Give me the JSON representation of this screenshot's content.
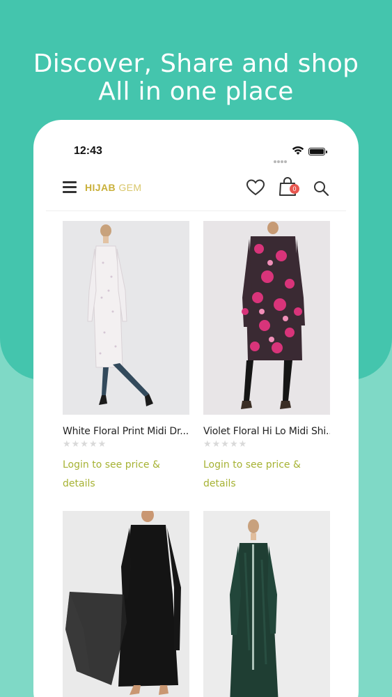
{
  "headline": {
    "line1": "Discover, Share and shop",
    "line2": "All in one place"
  },
  "status_bar": {
    "time": "12:43"
  },
  "app_bar": {
    "logo_primary": "HIJAB",
    "logo_secondary": "GEM",
    "cart_count": "0",
    "icons": [
      "menu-icon",
      "heart-icon",
      "shopping-bag-icon",
      "search-icon"
    ]
  },
  "products": [
    {
      "title": "White Floral Print Midi Dr...",
      "rating_stars": "★★★★★",
      "login_text": "Login to see price &",
      "login_text2": "details"
    },
    {
      "title": "Violet Floral Hi Lo Midi Shi...",
      "rating_stars": "★★★★★",
      "login_text": "Login to see price &",
      "login_text2": "details"
    },
    {
      "title": "",
      "rating_stars": "",
      "login_text": "",
      "login_text2": ""
    },
    {
      "title": "",
      "rating_stars": "",
      "login_text": "",
      "login_text2": ""
    }
  ],
  "colors": {
    "background_top": "#44c5ad",
    "background_bottom": "#7fd9c6",
    "logo_gold": "#c9b03a",
    "login_link": "#a6b233",
    "badge_red": "#e8564f"
  }
}
